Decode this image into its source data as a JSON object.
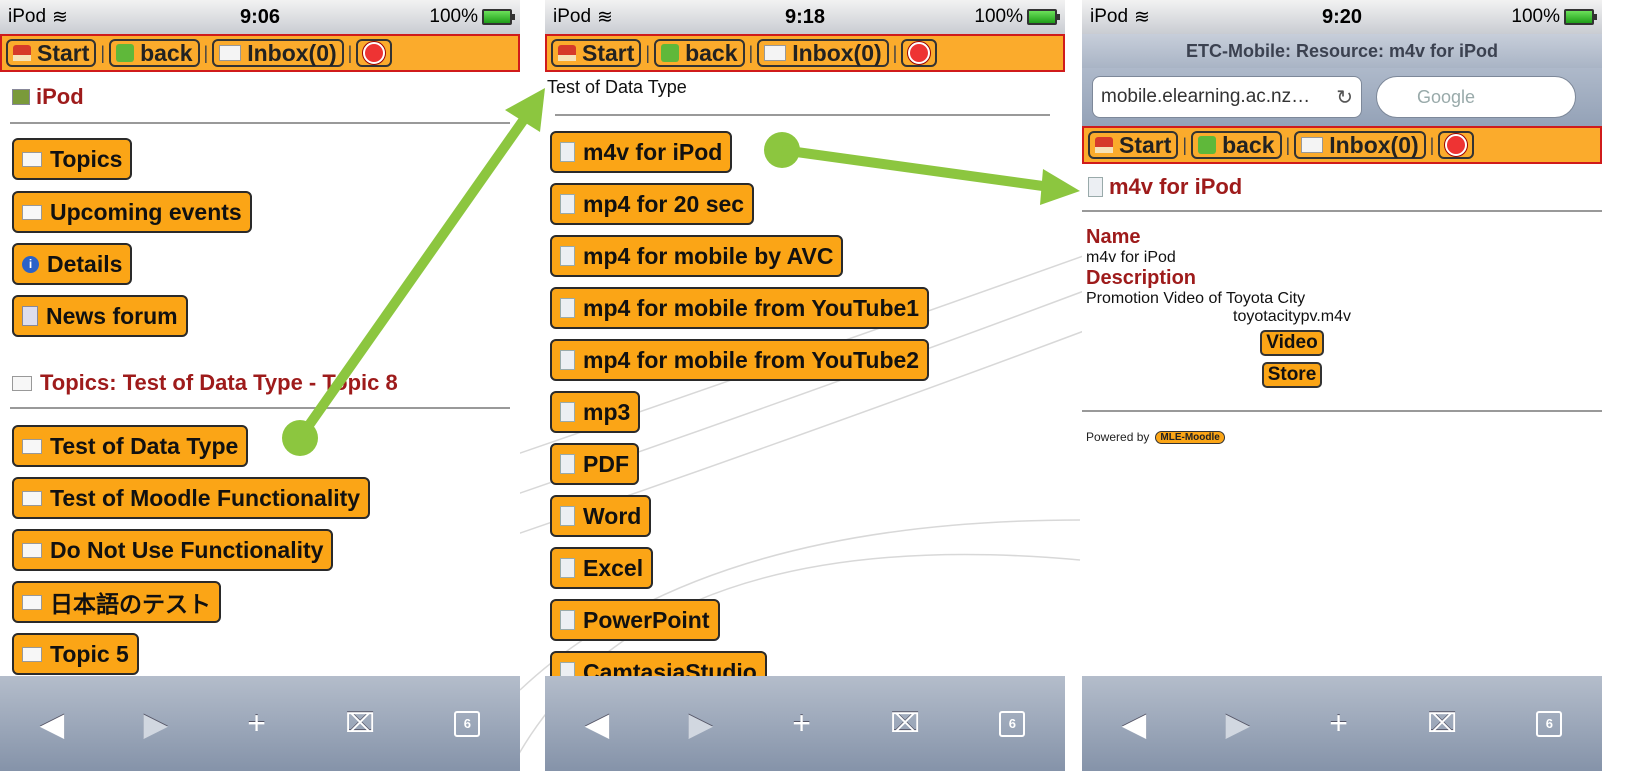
{
  "status": {
    "carrier": "iPod",
    "battery": "100%",
    "times": [
      "9:06",
      "9:18",
      "9:20"
    ]
  },
  "nav": {
    "start": "Start",
    "back": "back",
    "inbox": "Inbox(0)"
  },
  "phone1": {
    "crumb": "iPod",
    "menu": [
      {
        "label": "Topics",
        "icon": "folder-icon"
      },
      {
        "label": "Upcoming events",
        "icon": "calendar-icon"
      },
      {
        "label": "Details",
        "icon": "info-icon"
      },
      {
        "label": "News forum",
        "icon": "news-icon"
      }
    ],
    "section_title": "Topics: Test of Data Type - Topic 8",
    "topics": [
      "Test of Data Type",
      "Test of Moodle Functionality",
      "Do Not Use Functionality",
      "日本語のテスト",
      "Topic 5"
    ]
  },
  "phone2": {
    "crumb": "Test of Data Type",
    "resources": [
      "m4v for iPod",
      "mp4 for 20 sec",
      "mp4 for mobile by AVC",
      "mp4 for mobile from YouTube1",
      "mp4 for mobile from YouTube2",
      "mp3",
      "PDF",
      "Word",
      "Excel",
      "PowerPoint",
      "CamtasiaStudio"
    ]
  },
  "phone3": {
    "browser_title": "ETC-Mobile: Resource: m4v for iPod",
    "url": "mobile.elearning.ac.nz…",
    "search_placeholder": "Google",
    "crumb": "m4v for iPod",
    "name_label": "Name",
    "name_value": "m4v for iPod",
    "desc_label": "Description",
    "desc_value": "Promotion Video of Toyota City",
    "file": "toyotacitypv.m4v",
    "video_button": "Video",
    "store_button": "Store",
    "powered_by": "Powered by",
    "powered_badge": "MLE-Moodle"
  },
  "toolbar": {
    "tabs_count": "6"
  },
  "colors": {
    "accent_orange": "#fba516",
    "nav_border_red": "#d01b1b",
    "crumb_red": "#9e1b1b",
    "arrow_green": "#8cc63f"
  }
}
